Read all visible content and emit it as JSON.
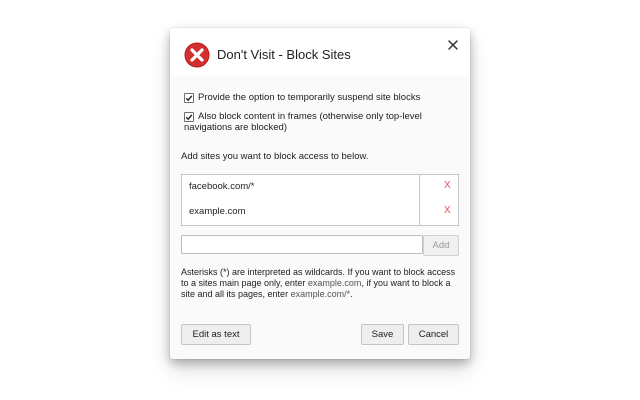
{
  "dialog": {
    "title": "Don't Visit - Block Sites",
    "logo_icon": "blocked-x-icon",
    "close_icon": "close-icon",
    "accent_color": "#d32f2f"
  },
  "options": [
    {
      "label": "Provide the option to temporarily suspend site blocks",
      "checked": true
    },
    {
      "label": "Also block content in frames (otherwise only top-level navigations are blocked)",
      "checked": true
    }
  ],
  "sites_label": "Add sites you want to block access to below.",
  "sites": [
    {
      "url": "facebook.com/*",
      "remove_label": "X"
    },
    {
      "url": "example.com",
      "remove_label": "X"
    }
  ],
  "add_input": {
    "value": "",
    "placeholder": ""
  },
  "add_button": "Add",
  "help": {
    "part1": "Asterisks (*) are interpreted as wildcards. If you want to block access to a sites main page only, enter ",
    "example1": "example.com",
    "part2": ", if you want to block a site and all its pages, enter ",
    "example2": "example.com/*",
    "part3": "."
  },
  "footer": {
    "edit_text": "Edit as text",
    "save": "Save",
    "cancel": "Cancel"
  }
}
